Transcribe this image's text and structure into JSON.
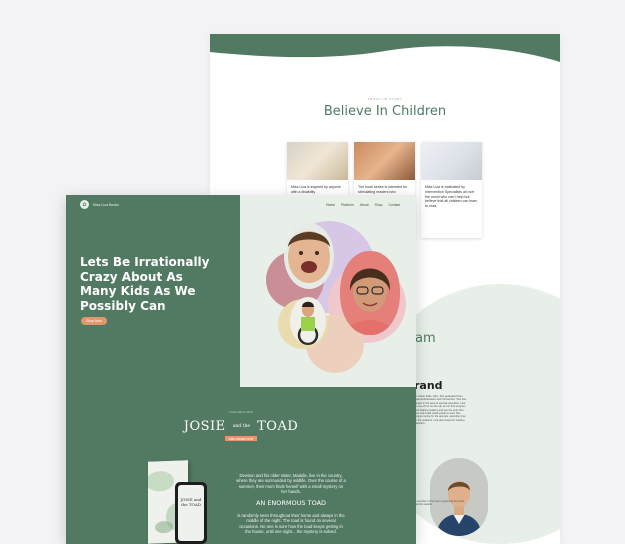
{
  "back_site": {
    "eyebrow": "ABOUT US STORY",
    "heading": "Believe In Children",
    "cards": [
      {
        "text": "Miss Liza is inspired by anyone with a disability"
      },
      {
        "text": "The book series is intended for stimulating readers who"
      },
      {
        "text": "Miss Liza is motivated by Intervention Specialists all over the world who can't help but believe that all children can learn to read."
      }
    ],
    "team_heading_fragment": "am",
    "member_name_fragment": "rand",
    "member_bio": "in Luther Falls, Ohio. She graduated from Special Education and Intervention. She has taught in the area of special education. Liza is one of her as she ran an her first program and helping readers and use the tools that can help build reading kids to read. She enjoys caring for the animals, spending time in the outdoors. Liza also helps fun reading partners.",
    "portrait_caption": "a member of the team supporting the book and its readers"
  },
  "front_site": {
    "logo_text": "Miss Liza Books",
    "nav": [
      "Home",
      "Platform",
      "About",
      "Shop",
      "Contact"
    ],
    "hero_title": "Lets Be Irrationally Crazy About As Many Kids As We Possibly Can",
    "shop_button": "Shop Now",
    "book_eyebrow": "AVAILABLE NOW",
    "book_title_left": "JOSIE",
    "book_title_mid": "and the",
    "book_title_right": "TOAD",
    "preorder_button": "PRE-ORDER NOW",
    "description": "Dewson and his older sister, Maddie, live in the country, where they are surrounded by wildlife. Over the course of a summer, their mom finds herself with a small mystery on her hands.",
    "subheading": "AN ENORMOUS TOAD",
    "description2": "is randomly seen throughout their home and always in the middle of the night. The toad is found on several occasions. No one is sure how the toad keeps getting in the house, until one night... the mystery is solved.",
    "phone_title": "JOSIE and the TOAD"
  },
  "colors": {
    "brand_green": "#527a62",
    "light_green": "#e8efe9",
    "accent_orange": "#e0986b"
  }
}
